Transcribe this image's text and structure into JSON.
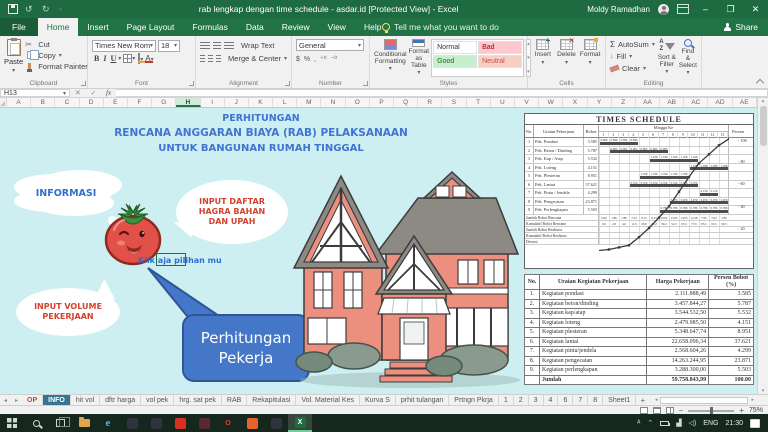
{
  "titlebar": {
    "title": "rab lengkap dengan time schedule - asdar.id  [Protected View]  -  Excel",
    "user": "Moldy Ramadhan",
    "minimize": "–",
    "restore": "❐",
    "close": "✕"
  },
  "ribbon": {
    "tabs": [
      {
        "label": "File",
        "cls": "file"
      },
      {
        "label": "Home",
        "cls": "active"
      },
      {
        "label": "Insert"
      },
      {
        "label": "Page Layout"
      },
      {
        "label": "Formulas"
      },
      {
        "label": "Data"
      },
      {
        "label": "Review"
      },
      {
        "label": "View"
      },
      {
        "label": "Help"
      }
    ],
    "tell_me": "Tell me what you want to do",
    "share": "Share",
    "clipboard": {
      "title": "Clipboard",
      "paste": "Paste",
      "cut": "Cut",
      "copy": "Copy",
      "format_painter": "Format Painter"
    },
    "font": {
      "title": "Font",
      "name": "Times New Rom",
      "size": "18",
      "grow": "A",
      "shrink": "A",
      "bold": "B",
      "italic": "I",
      "underline": "U"
    },
    "alignment": {
      "title": "Alignment",
      "wrap": "Wrap Text",
      "merge": "Merge & Center"
    },
    "number": {
      "title": "Number",
      "format": "General",
      "icons": [
        "$",
        "%",
        ",",
        "⁺⁰",
        "⁻⁰"
      ]
    },
    "styles": {
      "title": "Styles",
      "conditional": "Conditional Formatting",
      "format_table": "Format as Table",
      "cells": [
        {
          "label": "Normal",
          "cls": "st-normal"
        },
        {
          "label": "Bad",
          "cls": "st-bad"
        },
        {
          "label": "Good",
          "cls": "st-good"
        },
        {
          "label": "Neutral",
          "cls": "st-neutral"
        }
      ]
    },
    "cells": {
      "title": "Cells",
      "insert": "Insert",
      "delete": "Delete",
      "format": "Format"
    },
    "editing": {
      "title": "Editing",
      "autosum": "AutoSum",
      "fill": "Fill",
      "clear": "Clear",
      "sort": "Sort & Filter",
      "find": "Find & Select"
    }
  },
  "formula_bar": {
    "name_box": "H13",
    "fx": "fx",
    "cancel": "✕",
    "enter": "✓"
  },
  "columns": [
    "A",
    "B",
    "C",
    "D",
    "E",
    "F",
    "G",
    "H",
    "I",
    "J",
    "K",
    "L",
    "M",
    "N",
    "O",
    "P",
    "Q",
    "R",
    "S",
    "T",
    "U",
    "V",
    "W",
    "X",
    "Y",
    "Z",
    "AA",
    "AB",
    "AC",
    "AD",
    "AE"
  ],
  "canvas": {
    "title_lines": [
      "PERHITUNGAN",
      "RENCANA ANGGARAN BIAYA (RAB) PELAKSANAAN",
      "UNTUK BANGUNAN RUMAH TINGGAL"
    ],
    "informasi": "INFORMASI",
    "bubble_top": [
      "INPUT DAFTAR",
      "HAGRA BAHAN",
      "DAN UPAH"
    ],
    "bubble_left": [
      "INPUT VOLUME",
      "PEKERJAAN"
    ],
    "klik": "Klik aja pilihan mu",
    "button_lines": [
      "Perhitungan",
      "Pekerja"
    ]
  },
  "chart_data": {
    "type": "table",
    "title": "TIMES SCHEDULE",
    "header": {
      "no": "No.",
      "uraian": "Uraian Pekerjaan",
      "bobot": "Bobot",
      "minggu": "Minggu Ke",
      "persen": "Persen"
    },
    "weeks": [
      "1",
      "2",
      "3",
      "4",
      "5",
      "6",
      "7",
      "8",
      "9",
      "10",
      "11",
      "12",
      "13"
    ],
    "rows": [
      {
        "no": "1",
        "label": "Pek. Pondasi",
        "bobot": "3.585",
        "start": 1,
        "end": 4,
        "weekly": 0.896
      },
      {
        "no": "2",
        "label": "Pek. Beton / Dinding",
        "bobot": "5.787",
        "start": 2,
        "end": 7,
        "weekly": 0.965
      },
      {
        "no": "3",
        "label": "Pek. Kap / Atap",
        "bobot": "5.532",
        "start": 6,
        "end": 10,
        "weekly": 1.106
      },
      {
        "no": "4",
        "label": "Pek. Loteng",
        "bobot": "4.151",
        "start": 10,
        "end": 13,
        "weekly": 1.038
      },
      {
        "no": "5",
        "label": "Pek. Plesteran",
        "bobot": "8.951",
        "start": 5,
        "end": 9,
        "weekly": 1.79
      },
      {
        "no": "6",
        "label": "Pek. Lantai",
        "bobot": "37.621",
        "start": 4,
        "end": 10,
        "weekly": 5.374
      },
      {
        "no": "7",
        "label": "Pek. Pintu / Jendela",
        "bobot": "4.299",
        "start": 11,
        "end": 12,
        "weekly": 2.15
      },
      {
        "no": "8",
        "label": "Pek. Pengecatan",
        "bobot": "23.871",
        "start": 8,
        "end": 13,
        "weekly": 3.979
      },
      {
        "no": "9",
        "label": "Pek. Perlengkapan",
        "bobot": "5.503",
        "start": 7,
        "end": 13,
        "weekly": 0.786
      }
    ],
    "summary_rows": [
      "Jumlah Bobot Rencana",
      "Kumulatif Bobot Rencana",
      "Jumlah Bobot Realisasi",
      "Kumulatif Bobot Realisasi",
      "Deviasi"
    ],
    "persen_axis": [
      "100",
      "80",
      "60",
      "40",
      "20"
    ],
    "curve": {
      "type": "line",
      "name": "Kumulatif Bobot Rencana (Kurva S)",
      "ylim": [
        0,
        100
      ]
    }
  },
  "activity_table": {
    "headers": {
      "no": "No.",
      "uraian": "Uraian Kegiatan Pekerjaan",
      "harga": "Harga Pekerjaan",
      "persen1": "Persen Bobot",
      "persen2": "(%)"
    },
    "rows": [
      {
        "no": "1.",
        "uraian": "Kegiatan pondasi",
        "harga": "2.111.888,49",
        "persen": "3.585"
      },
      {
        "no": "2.",
        "uraian": "Kegiatan beton/dinding",
        "harga": "3.457.844,27",
        "persen": "5.787"
      },
      {
        "no": "3.",
        "uraian": "Kegiatan kap/atap",
        "harga": "3.544.532,50",
        "persen": "5.532"
      },
      {
        "no": "4.",
        "uraian": "Kegiatan loteng",
        "harga": "2.479.985,50",
        "persen": "4.151"
      },
      {
        "no": "5.",
        "uraian": "Kegiatan plesteran",
        "harga": "5.348.647,74",
        "persen": "8.951"
      },
      {
        "no": "6.",
        "uraian": "Kegiatan lantai",
        "harga": "22.658.096,34",
        "persen": "37.621"
      },
      {
        "no": "7.",
        "uraian": "Kegiatan pintu/jendela",
        "harga": "2.568.604,26",
        "persen": "4.299"
      },
      {
        "no": "8.",
        "uraian": "Kegiatan pengecatan",
        "harga": "14.263.244,95",
        "persen": "23.871"
      },
      {
        "no": "9.",
        "uraian": "Kegiatan perlengkapan",
        "harga": "3.288.300,00",
        "persen": "5.503"
      }
    ],
    "footer": {
      "uraian": "Jumlah",
      "harga": "59.758.843,99",
      "persen": "100.00"
    }
  },
  "sheet_tabs": {
    "items": [
      {
        "label": "OP",
        "cls": "op"
      },
      {
        "label": "INFO",
        "cls": "active"
      },
      {
        "label": "hit vol"
      },
      {
        "label": "dftr harga"
      },
      {
        "label": "vol pek"
      },
      {
        "label": "hrg. sat pek"
      },
      {
        "label": "RAB"
      },
      {
        "label": "Rekapitulasi"
      },
      {
        "label": "Vol. Material Kes"
      },
      {
        "label": "Kurva S"
      },
      {
        "label": "prhit tulangan"
      },
      {
        "label": "Prtngn Pkrja"
      },
      {
        "label": "1"
      },
      {
        "label": "2"
      },
      {
        "label": "3"
      },
      {
        "label": "4"
      },
      {
        "label": "6"
      },
      {
        "label": "7"
      },
      {
        "label": "8"
      },
      {
        "label": "Sheet1"
      }
    ],
    "add": "+"
  },
  "status": {
    "zoom": "75%",
    "minus": "−",
    "plus": "+"
  },
  "taskbar": {
    "apps": [
      {
        "name": "taskbar-app-dark-1",
        "bg": "#30323d",
        "glyph": ""
      },
      {
        "name": "taskbar-app-dark-2",
        "bg": "#30323d",
        "glyph": ""
      },
      {
        "name": "taskbar-app-red",
        "bg": "#d93025",
        "glyph": ""
      },
      {
        "name": "taskbar-app-maroon",
        "bg": "#5b2731",
        "glyph": ""
      },
      {
        "name": "taskbar-app-opera",
        "bg": "transparent",
        "glyph": "O",
        "fg": "#e23b2e"
      },
      {
        "name": "taskbar-app-orange",
        "bg": "#e8632c",
        "glyph": ""
      },
      {
        "name": "taskbar-app-dark-3",
        "bg": "#30323d",
        "glyph": ""
      }
    ],
    "edge_glyph": "e",
    "excel_glyph": "X",
    "lang": "ENG",
    "time": "21:30",
    "chevron": "⌃"
  },
  "colors": {
    "excel_green": "#217346",
    "canvas_cyan": "#cdeff1",
    "button_blue": "#4577c8",
    "bubble_red": "#d2422e",
    "title_blue": "#3f74d2",
    "house_wall": "#ec8f7f",
    "roof_gray": "#8d8a84"
  }
}
